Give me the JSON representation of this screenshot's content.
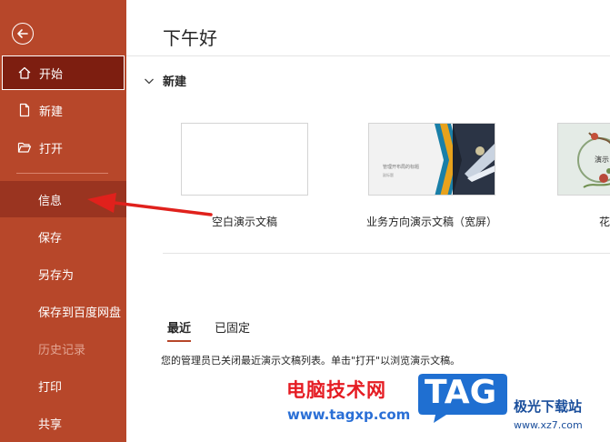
{
  "sidebar": {
    "items": [
      {
        "label": "开始"
      },
      {
        "label": "新建"
      },
      {
        "label": "打开"
      },
      {
        "label": "信息"
      },
      {
        "label": "保存"
      },
      {
        "label": "另存为"
      },
      {
        "label": "保存到百度网盘"
      },
      {
        "label": "历史记录"
      },
      {
        "label": "打印"
      },
      {
        "label": "共享"
      }
    ],
    "colors": {
      "background": "#b7472a",
      "active": "#7d1e10"
    }
  },
  "main": {
    "greeting": "下午好",
    "new_section": {
      "title": "新建",
      "templates": [
        {
          "caption": "空白演示文稿"
        },
        {
          "caption": "业务方向演示文稿（宽屏）",
          "thumb_title": "管理开布局的标题",
          "thumb_subtitle": "副标题"
        },
        {
          "caption": "花",
          "thumb_title": "演示"
        }
      ]
    },
    "tabs": [
      {
        "label": "最近"
      },
      {
        "label": "已固定"
      }
    ],
    "notice": "您的管理员已关闭最近演示文稿列表。单击\"打开\"以浏览演示文稿。"
  },
  "watermark": {
    "text": "电脑技术网",
    "url": "www.tagxp.com",
    "logo": "TAG",
    "cn": "极光下载站",
    "site": "www.xz7.com"
  }
}
